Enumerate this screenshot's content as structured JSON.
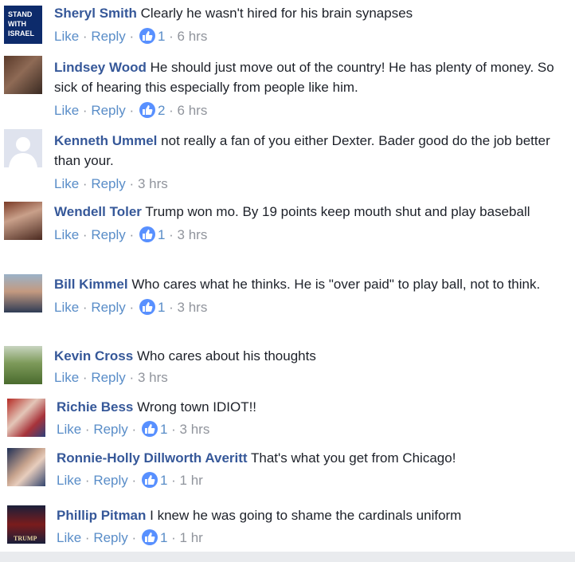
{
  "actions": {
    "like_label": "Like",
    "reply_label": "Reply",
    "separator": "·"
  },
  "comments": [
    {
      "author": "Sheryl Smith",
      "text": "Clearly he wasn't hired for his brain synapses",
      "likes": "1",
      "time": "6 hrs",
      "avatar_text_1": "STAND",
      "avatar_text_2": "WITH",
      "avatar_text_3": "ISRAEL"
    },
    {
      "author": "Lindsey Wood",
      "text": "He should just move out of the country! He has plenty of money. So sick of hearing this especially from people like him.",
      "likes": "2",
      "time": "6 hrs"
    },
    {
      "author": "Kenneth Ummel",
      "text": "not really a fan of you either Dexter. Bader good do the job better than your.",
      "likes": "",
      "time": "3 hrs"
    },
    {
      "author": "Wendell Toler",
      "text": "Trump won mo. By 19 points keep mouth shut and play baseball",
      "likes": "1",
      "time": "3 hrs"
    },
    {
      "author": "Bill Kimmel",
      "text": "Who cares what he thinks. He is \"over paid\" to play ball, not to think.",
      "likes": "1",
      "time": "3 hrs"
    },
    {
      "author": "Kevin Cross",
      "text": "Who cares about his thoughts",
      "likes": "",
      "time": "3 hrs"
    },
    {
      "author": "Richie Bess",
      "text": "Wrong town IDIOT!!",
      "likes": "1",
      "time": "3 hrs"
    },
    {
      "author": "Ronnie-Holly Dillworth Averitt",
      "text": "That's what you get from Chicago!",
      "likes": "1",
      "time": "1 hr"
    },
    {
      "author": "Phillip Pitman",
      "text": "I knew he was going to shame the cardinals uniform",
      "likes": "1",
      "time": "1 hr",
      "avatar_text_1": "TRUMP"
    }
  ]
}
